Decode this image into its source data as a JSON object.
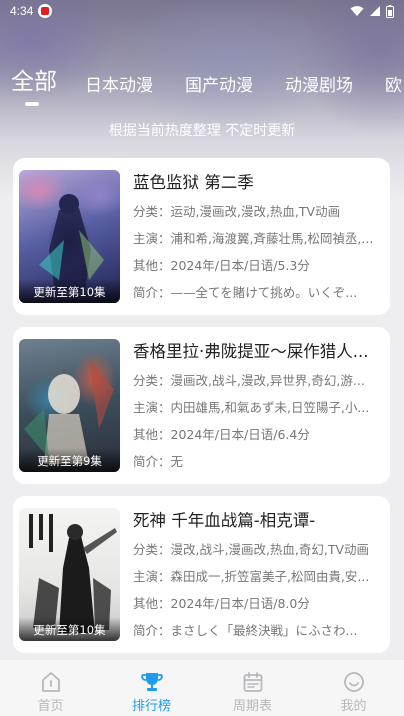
{
  "status": {
    "time": "4:34"
  },
  "tabs": [
    {
      "label": "全部",
      "active": true
    },
    {
      "label": "日本动漫",
      "active": false
    },
    {
      "label": "国产动漫",
      "active": false
    },
    {
      "label": "动漫剧场",
      "active": false
    },
    {
      "label": "欧",
      "active": false
    }
  ],
  "subtitle": "根据当前热度整理 不定时更新",
  "cards": [
    {
      "title": "蓝色监狱 第二季",
      "episode": "更新至第10集",
      "category": "分类：运动,漫画改,漫改,热血,TV动画",
      "cast": "主演：浦和希,海渡翼,斉藤壮馬,松岡禎丞,...",
      "other": "其他：2024年/日本/日语/5.3分",
      "intro": "简介：——全てを賭けて挑め。いくぞ..."
    },
    {
      "title": "香格里拉·弗陇提亚～屎作猎人...",
      "episode": "更新至第9集",
      "category": "分类：漫画改,战斗,漫改,异世界,奇幻,游...",
      "cast": "主演：内田雄馬,和氣あず未,日笠陽子,小...",
      "other": "其他：2024年/日本/日语/6.4分",
      "intro": "简介：无"
    },
    {
      "title": "死神 千年血战篇-相克谭-",
      "episode": "更新至第10集",
      "category": "分类：漫改,战斗,漫画改,热血,奇幻,TV动画",
      "cast": "主演：森田成一,折笠富美子,松岡由貴,安...",
      "other": "其他：2024年/日本/日语/8.0分",
      "intro": "简介：まさしく「最終決戦」にふさわ..."
    }
  ],
  "nav": [
    {
      "label": "首页",
      "icon": "home-icon",
      "active": false
    },
    {
      "label": "排行榜",
      "icon": "trophy-icon",
      "active": true
    },
    {
      "label": "周期表",
      "icon": "calendar-icon",
      "active": false
    },
    {
      "label": "我的",
      "icon": "profile-icon",
      "active": false
    }
  ],
  "colors": {
    "accent": "#1f9cf0",
    "inactive_nav": "#b8b8bc"
  }
}
